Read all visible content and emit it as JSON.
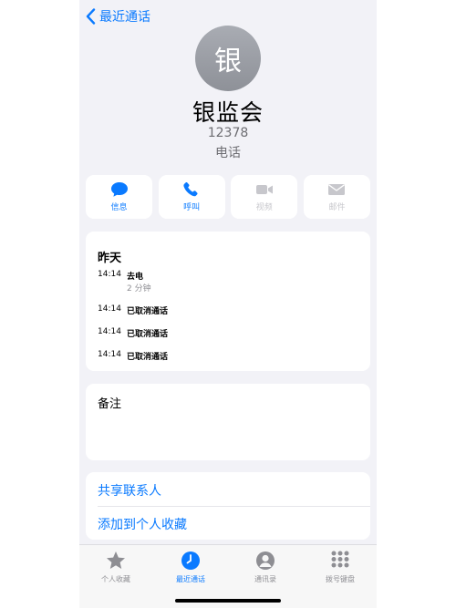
{
  "nav": {
    "back_label": "最近通话"
  },
  "contact": {
    "avatar_char": "银",
    "name": "银监会",
    "number": "12378",
    "label": "电话"
  },
  "actions": [
    {
      "label": "信息",
      "icon": "message-icon",
      "enabled": true
    },
    {
      "label": "呼叫",
      "icon": "phone-icon",
      "enabled": true
    },
    {
      "label": "视频",
      "icon": "video-icon",
      "enabled": false
    },
    {
      "label": "邮件",
      "icon": "mail-icon",
      "enabled": false
    }
  ],
  "history": {
    "title": "昨天",
    "rows": [
      {
        "time": "14:14",
        "type": "去电",
        "duration": "2 分钟"
      },
      {
        "time": "14:14",
        "type": "已取消通话"
      },
      {
        "time": "14:14",
        "type": "已取消通话"
      },
      {
        "time": "14:14",
        "type": "已取消通话"
      }
    ]
  },
  "notes": {
    "title": "备注"
  },
  "links": {
    "share": "共享联系人",
    "favorite": "添加到个人收藏"
  },
  "tabs": [
    {
      "label": "个人收藏",
      "icon": "star-icon"
    },
    {
      "label": "最近通话",
      "icon": "clock-icon",
      "active": true
    },
    {
      "label": "通讯录",
      "icon": "person-icon"
    },
    {
      "label": "拨号键盘",
      "icon": "keypad-icon"
    }
  ],
  "colors": {
    "accent": "#0a7aff",
    "background": "#f2f2f7",
    "disabled": "#c7c7cc"
  }
}
